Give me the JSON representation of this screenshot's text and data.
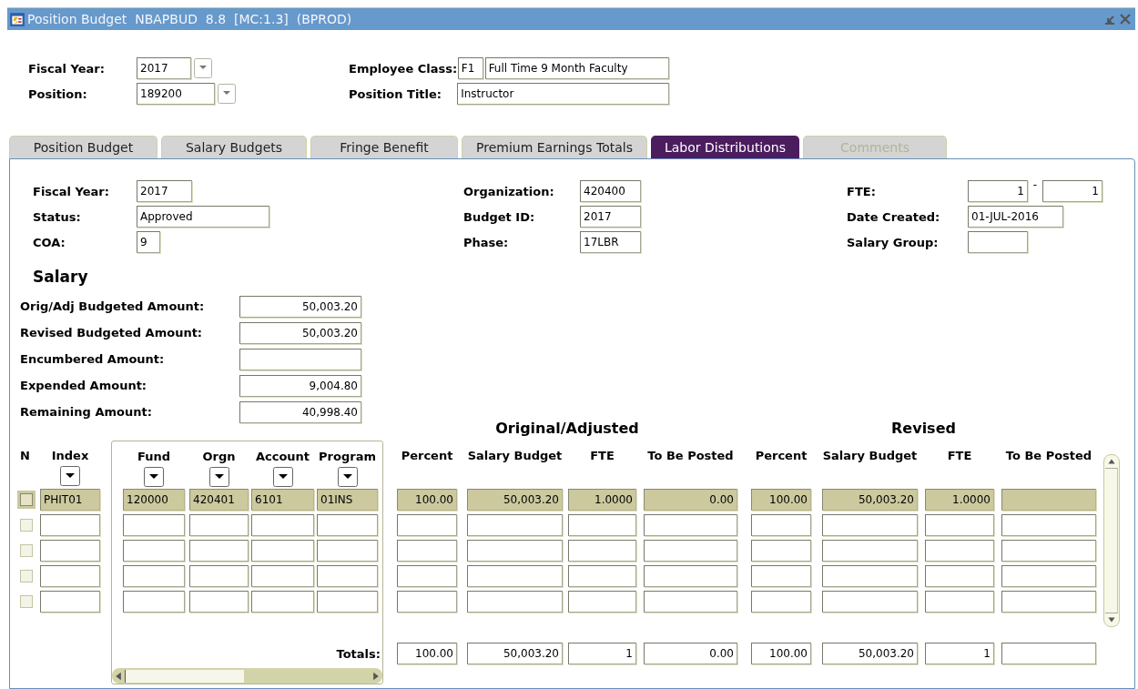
{
  "window": {
    "title": "Position Budget  NBAPBUD  8.8  [MC:1.3]  (BPROD)"
  },
  "key_block": {
    "left": [
      {
        "label": "Fiscal Year:",
        "value": "2017",
        "lookup": true
      },
      {
        "label": "Position:",
        "value": "189200",
        "lookup": true
      }
    ],
    "right": [
      {
        "label": "Employee Class:",
        "code": "F1",
        "value": "Full Time 9 Month Faculty"
      },
      {
        "label": "Position Title:",
        "value": "Instructor"
      }
    ]
  },
  "tabs": [
    {
      "label": "Position Budget",
      "selected": false,
      "disabled": false
    },
    {
      "label": "Salary Budgets",
      "selected": false,
      "disabled": false
    },
    {
      "label": "Fringe Benefit",
      "selected": false,
      "disabled": false
    },
    {
      "label": "Premium Earnings Totals",
      "selected": false,
      "disabled": false
    },
    {
      "label": "Labor Distributions",
      "selected": true,
      "disabled": false
    },
    {
      "label": "Comments",
      "selected": false,
      "disabled": true
    }
  ],
  "header_fields": [
    [
      {
        "label": "Fiscal Year:",
        "values": [
          "2017"
        ]
      },
      {
        "label": "Organization:",
        "values": [
          "420400"
        ]
      },
      {
        "label": "FTE:",
        "values": [
          "1",
          "1"
        ],
        "range_separator": "-"
      }
    ],
    [
      {
        "label": "Status:",
        "values": [
          "Approved"
        ]
      },
      {
        "label": "Budget ID:",
        "values": [
          "2017"
        ]
      },
      {
        "label": "Date Created:",
        "values": [
          "01-JUL-2016"
        ]
      }
    ],
    [
      {
        "label": "COA:",
        "values": [
          "9"
        ]
      },
      {
        "label": "Phase:",
        "values": [
          "17LBR"
        ]
      },
      {
        "label": "Salary Group:"
      }
    ]
  ],
  "salary": {
    "title": "Salary",
    "rows": [
      {
        "label": "Orig/Adj Budgeted Amount:",
        "value": "50,003.20"
      },
      {
        "label": "Revised Budgeted Amount:",
        "value": "50,003.20"
      },
      {
        "label": "Encumbered Amount:",
        "value": null
      },
      {
        "label": "Expended Amount:",
        "value": "9,004.80"
      },
      {
        "label": "Remaining Amount:",
        "value": "40,998.40"
      }
    ]
  },
  "labor": {
    "group_headings": [
      "Original/Adjusted",
      "Revised"
    ],
    "check_column": "N",
    "columns": [
      {
        "label": "Index",
        "lookup": true
      },
      {
        "label": "Fund",
        "lookup": true
      },
      {
        "label": "Orgn",
        "lookup": true
      },
      {
        "label": "Account",
        "lookup": true
      },
      {
        "label": "Program",
        "lookup": true
      },
      {
        "label": "Percent"
      },
      {
        "label": "Salary Budget"
      },
      {
        "label": "FTE"
      },
      {
        "label": "To Be Posted"
      },
      {
        "label": "Percent"
      },
      {
        "label": "Salary Budget"
      },
      {
        "label": "FTE"
      },
      {
        "label": "To Be Posted"
      }
    ],
    "rows": [
      {
        "selected": true,
        "checked": false,
        "cells": [
          "PHIT01",
          "120000",
          "420401",
          "6101",
          "01INS",
          "100.00",
          "50,003.20",
          "1.0000",
          "0.00",
          "100.00",
          "50,003.20",
          "1.0000"
        ]
      },
      {
        "selected": false,
        "checked": false
      },
      {
        "selected": false,
        "checked": false
      },
      {
        "selected": false,
        "checked": false
      },
      {
        "selected": false,
        "checked": false
      }
    ],
    "totals_label": "Totals:",
    "totals": [
      "100.00",
      "50,003.20",
      "1",
      "0.00",
      "100.00",
      "50,003.20",
      "1"
    ]
  }
}
